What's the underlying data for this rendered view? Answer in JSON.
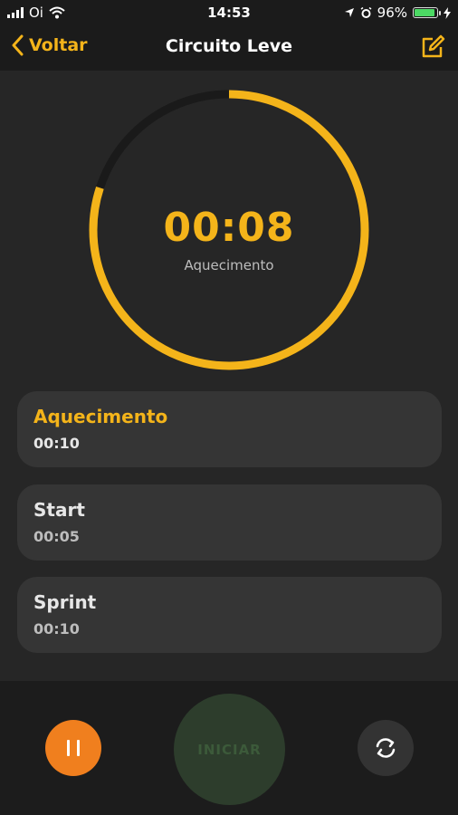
{
  "status": {
    "carrier": "Oi",
    "time": "14:53",
    "battery": "96%"
  },
  "nav": {
    "back_label": "Voltar",
    "title": "Circuito Leve"
  },
  "timer": {
    "time": "00:08",
    "phase": "Aquecimento",
    "progress": 0.8
  },
  "intervals": [
    {
      "name": "Aquecimento",
      "duration": "00:10"
    },
    {
      "name": "Start",
      "duration": "00:05"
    },
    {
      "name": "Sprint",
      "duration": "00:10"
    }
  ],
  "controls": {
    "start_label": "INICIAR"
  },
  "colors": {
    "accent": "#f4b41a",
    "pause": "#f07f1e",
    "start": "#2d3d2c"
  }
}
